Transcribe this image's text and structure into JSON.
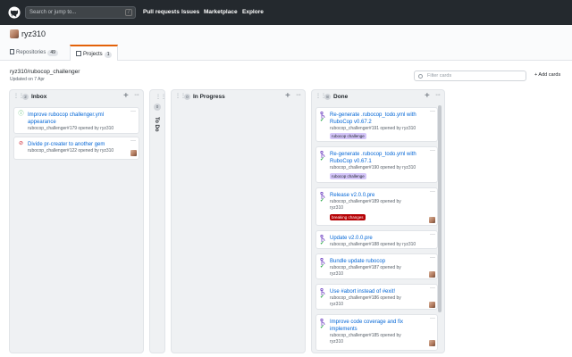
{
  "nav": {
    "search_placeholder": "Search or jump to...",
    "search_shortcut": "/",
    "links": [
      "Pull requests",
      "Issues",
      "Marketplace",
      "Explore"
    ]
  },
  "repo": {
    "owner": "ryz310",
    "tabs": [
      {
        "label": "Repositories",
        "count": "49"
      },
      {
        "label": "Projects",
        "count": "1"
      }
    ]
  },
  "project": {
    "title": "ryz310/rubocop_challenger",
    "updated": "Updated on 7 Apr",
    "filter_placeholder": "Filter cards",
    "add_cards": "+ Add cards"
  },
  "columns": {
    "inbox": {
      "count": "2",
      "title": "Inbox",
      "cards": [
        {
          "title": "Improve rubocop challenger.yml appearance",
          "meta": "rubocop_challenger#179 opened by ryz310",
          "state": "open"
        },
        {
          "title": "Divide pr-creater to another gem",
          "meta": "rubocop_challenger#122 opened by ryz310",
          "state": "closed"
        }
      ]
    },
    "todo": {
      "count": "0",
      "title": "To Do"
    },
    "in_progress": {
      "count": "0",
      "title": "In Progress"
    },
    "done": {
      "count": "8",
      "title": "Done",
      "cards": [
        {
          "title": "Re-generate .rubocop_todo.yml with RuboCop v0.67.2",
          "meta": "rubocop_challenger#191 opened by ryz310",
          "label": "rubocop challenge"
        },
        {
          "title": "Re-generate .rubocop_todo.yml with RuboCop v0.67.1",
          "meta": "rubocop_challenger#190 opened by ryz310",
          "label": "rubocop challenge"
        },
        {
          "title": "Release v2.0.0.pre",
          "meta": "rubocop_challenger#189 opened by ryz310",
          "label": "breaking changes"
        },
        {
          "title": "Update v2.0.0.pre",
          "meta": "rubocop_challenger#188 opened by ryz310"
        },
        {
          "title": "Bundle update rubocop",
          "meta": "rubocop_challenger#187 opened by ryz310"
        },
        {
          "title": "Use #abort instead of #exit!",
          "meta": "rubocop_challenger#186 opened by ryz310"
        },
        {
          "title": "Improve code coverage and fix implements",
          "meta": "rubocop_challenger#185 opened by ryz310"
        }
      ]
    }
  },
  "colors": {
    "topbar": "#24292e",
    "link": "#0366d6",
    "label_rubocop": "#d4c5f9",
    "label_breaking": "#b60205",
    "open": "#28a745",
    "closed": "#cb2431"
  }
}
